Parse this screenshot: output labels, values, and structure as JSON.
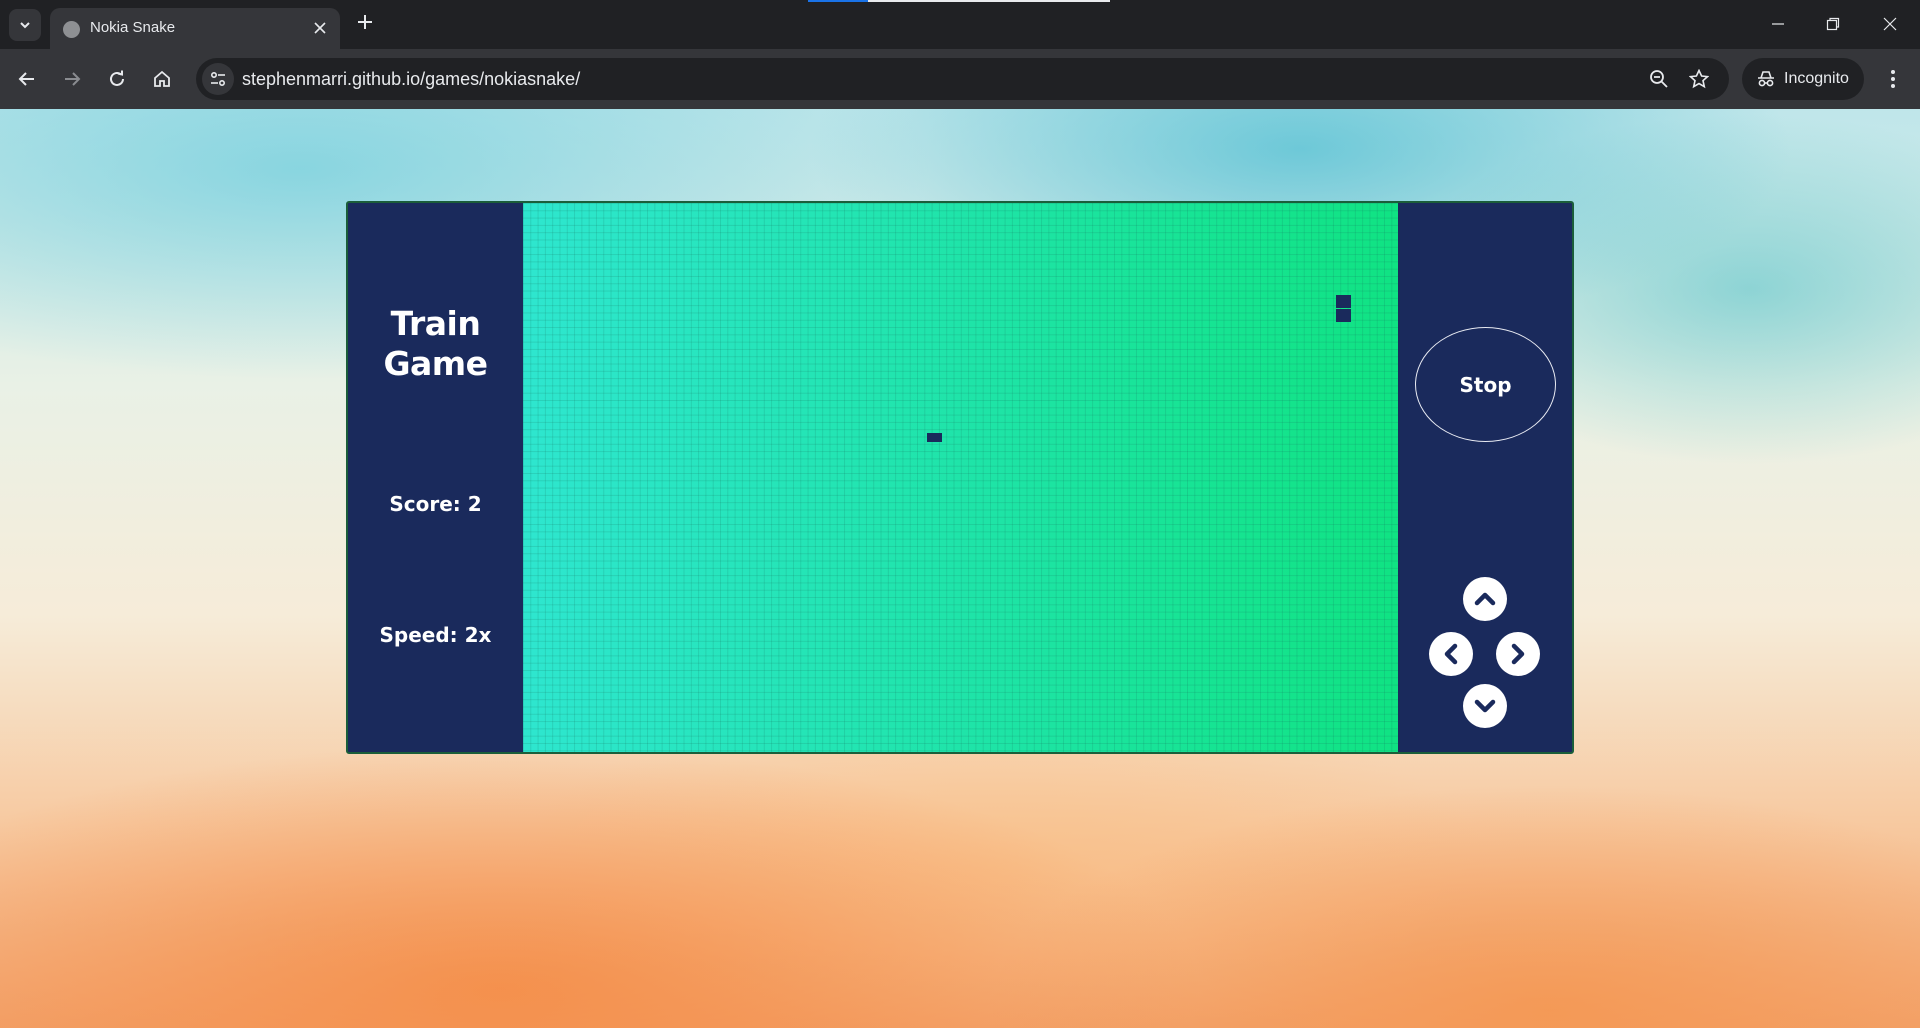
{
  "browser": {
    "tab": {
      "title": "Nokia Snake"
    },
    "address": {
      "url": "stephenmarri.github.io/games/nokiasnake/"
    },
    "incognito_label": "Incognito"
  },
  "game": {
    "title": "Train Game",
    "score_text": "Score: 2",
    "speed_text": "Speed: 2x",
    "stop_label": "Stop",
    "colors": {
      "panel": "#1a2a5c",
      "board_left": "#2ee6cf",
      "board_right": "#10e383",
      "snake": "#1a2a5c"
    }
  },
  "icons": {
    "tab_search": "chevron-down-icon",
    "favicon": "globe-icon",
    "tab_close": "close-icon",
    "new_tab": "plus-icon",
    "back": "arrow-left-icon",
    "forward": "arrow-right-icon",
    "reload": "reload-icon",
    "home": "home-icon",
    "site_info": "tune-icon",
    "zoom": "zoom-out-icon",
    "bookmark": "star-icon",
    "incognito": "incognito-icon",
    "menu": "kebab-menu-icon",
    "controls": [
      "chevron-up-icon",
      "chevron-left-icon",
      "chevron-right-icon",
      "chevron-down-icon"
    ]
  }
}
